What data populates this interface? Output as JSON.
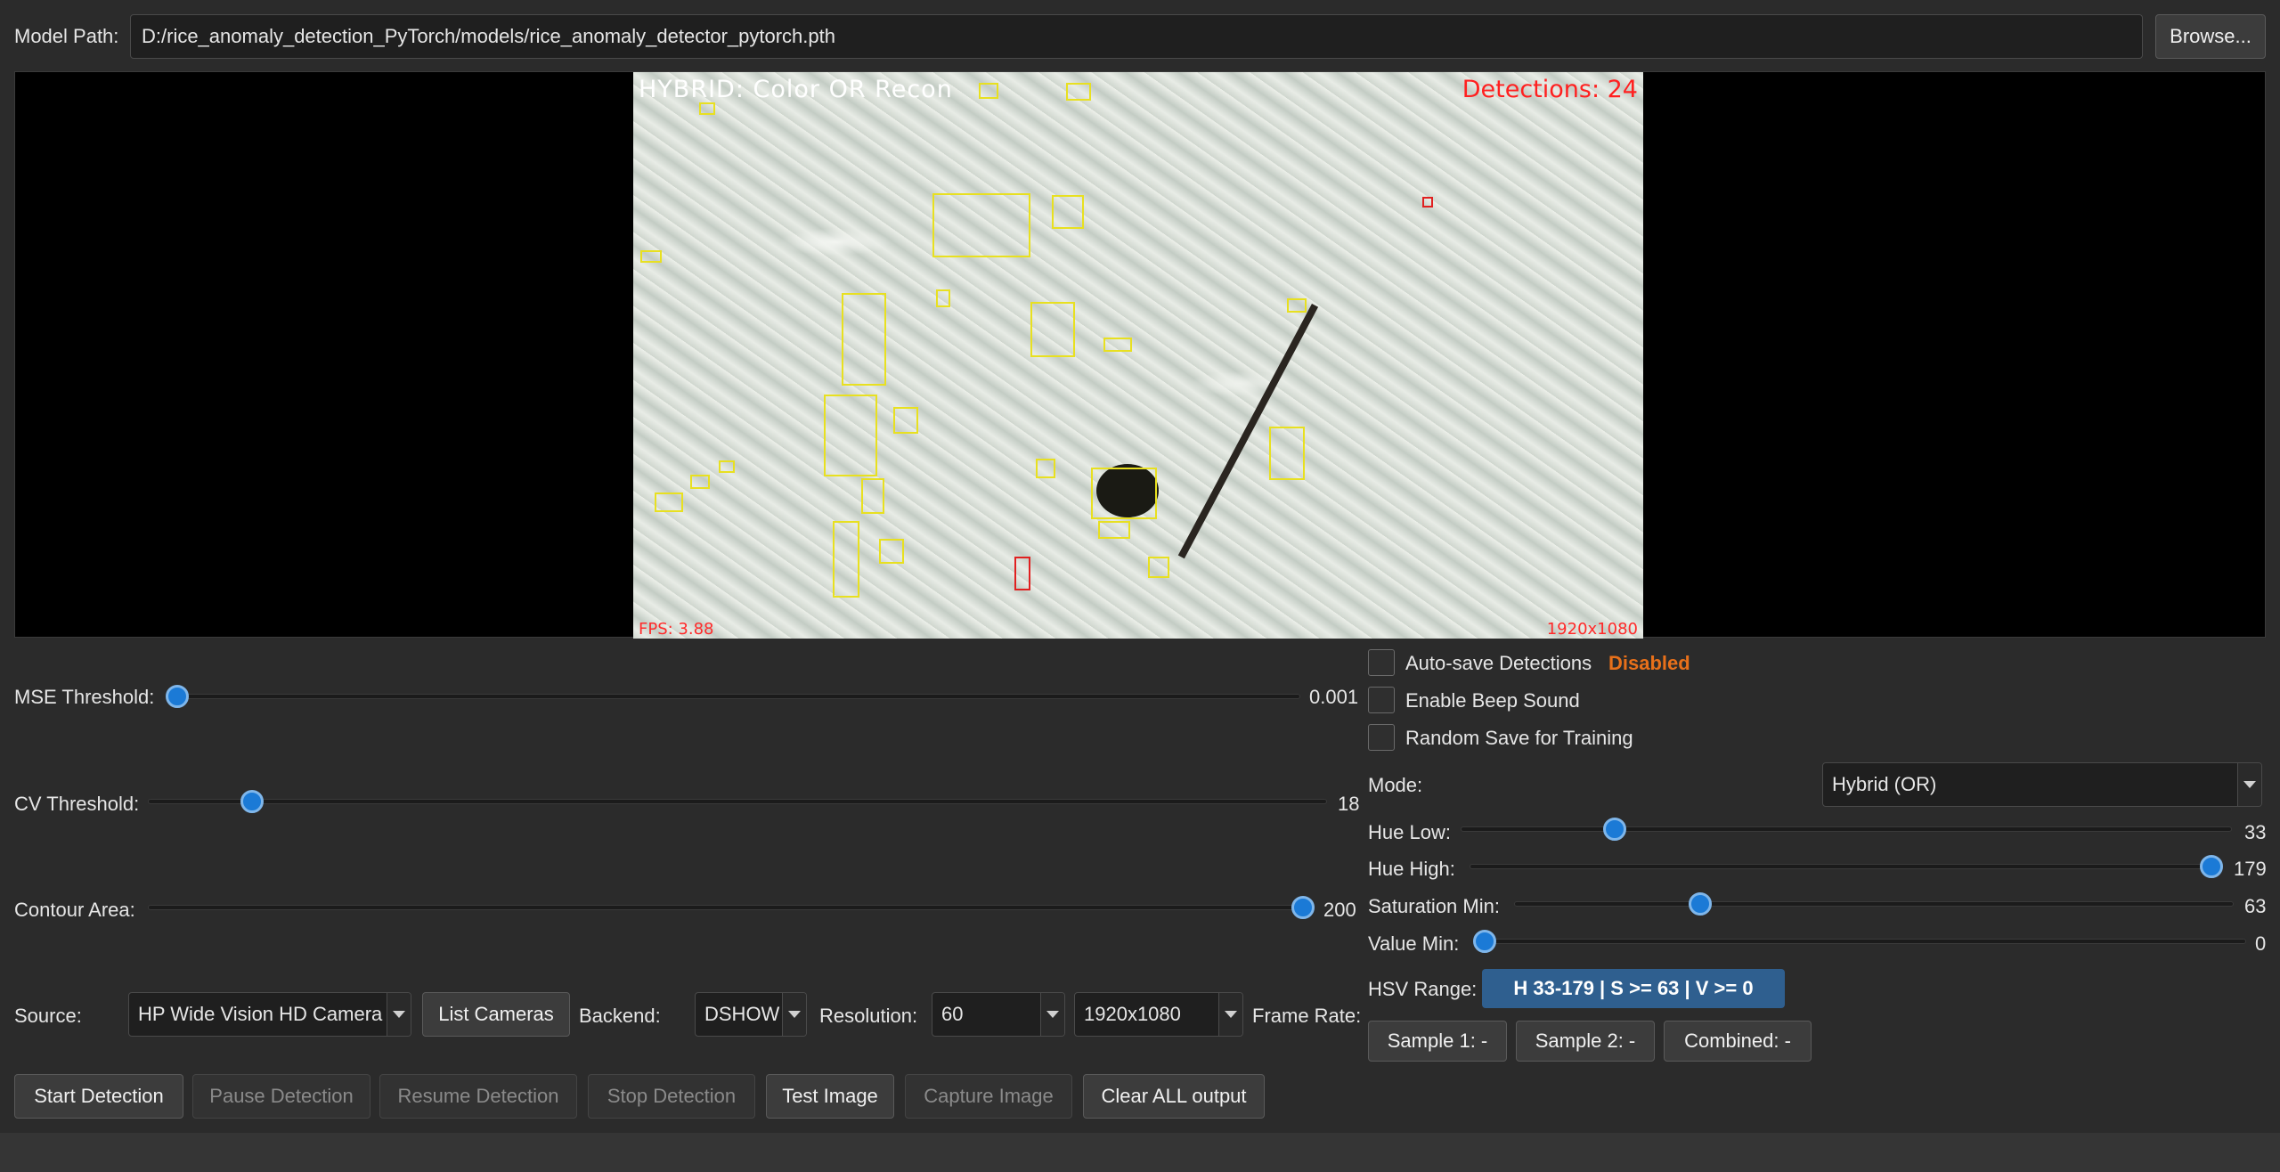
{
  "model": {
    "label": "Model Path:",
    "path": "D:/rice_anomaly_detection_PyTorch/models/rice_anomaly_detector_pytorch.pth",
    "browse_label": "Browse..."
  },
  "video": {
    "overlay_mode": "HYBRID: Color OR Recon",
    "detections": "Detections: 24",
    "fps": "FPS: 3.88",
    "resolution": "1920x1080"
  },
  "sliders": {
    "mse": {
      "label": "MSE Threshold:",
      "value": "0.001",
      "fraction": 0.0
    },
    "cv": {
      "label": "CV Threshold:",
      "value": "18",
      "fraction": 0.08
    },
    "contour": {
      "label": "Contour Area:",
      "value": "200",
      "fraction": 1.0
    }
  },
  "options": {
    "autosave_label": "Auto-save Detections",
    "autosave_status": "Disabled",
    "beep_label": "Enable Beep Sound",
    "random_save_label": "Random Save for Training"
  },
  "mode": {
    "label": "Mode:",
    "value": "Hybrid (OR)"
  },
  "hsv": {
    "hue_low": {
      "label": "Hue Low:",
      "value": "33",
      "fraction": 0.19
    },
    "hue_high": {
      "label": "Hue High:",
      "value": "179",
      "fraction": 1.0
    },
    "sat_min": {
      "label": "Saturation Min:",
      "value": "63",
      "fraction": 0.25
    },
    "val_min": {
      "label": "Value Min:",
      "value": "0",
      "fraction": 0.0
    },
    "range_label": "HSV Range:",
    "range_value": "H 33-179 | S >= 63 | V >= 0"
  },
  "samples": {
    "sample1": "Sample 1: -",
    "sample2": "Sample 2: -",
    "combined": "Combined: -"
  },
  "source": {
    "label": "Source:",
    "value": "HP Wide Vision HD Camera",
    "list_cameras": "List Cameras",
    "backend_label": "Backend:",
    "backend_value": "DSHOW",
    "resolution_label": "Resolution:",
    "resolution_value": "60",
    "frame_size_value": "1920x1080",
    "frame_rate_label": "Frame Rate:"
  },
  "actions": {
    "start": "Start Detection",
    "pause": "Pause Detection",
    "resume": "Resume Detection",
    "stop": "Stop Detection",
    "test_image": "Test Image",
    "capture": "Capture Image",
    "clear": "Clear ALL output"
  },
  "colors": {
    "accent": "#1b7ad6",
    "box": "#e8e020",
    "alert": "#e02020",
    "disabled_status": "#e8701a",
    "hsv_badge": "#2f5f8f"
  }
}
